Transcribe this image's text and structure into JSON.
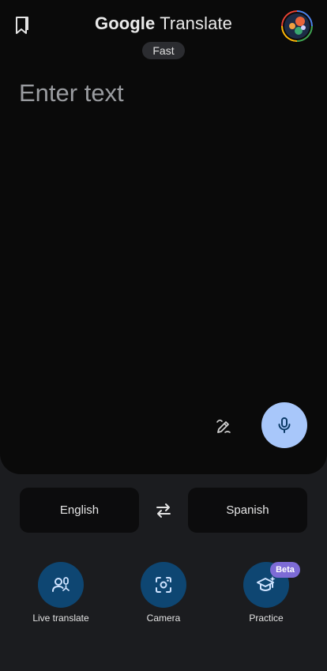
{
  "header": {
    "title_brand": "Google",
    "title_product": "Translate",
    "model_chip": "Fast"
  },
  "input": {
    "placeholder": "Enter text",
    "value": ""
  },
  "languages": {
    "source": "English",
    "target": "Spanish"
  },
  "actions": [
    {
      "label": "Live translate",
      "icon": "live-translate-icon"
    },
    {
      "label": "Camera",
      "icon": "camera-lens-icon"
    },
    {
      "label": "Practice",
      "icon": "practice-cap-icon",
      "badge": "Beta"
    }
  ],
  "colors": {
    "mic_button": "#a8c7fa",
    "action_circle": "#0e4672",
    "beta_badge": "#7d6bd6",
    "background": "#1b1c1f",
    "input_panel": "#0a0a0a"
  }
}
